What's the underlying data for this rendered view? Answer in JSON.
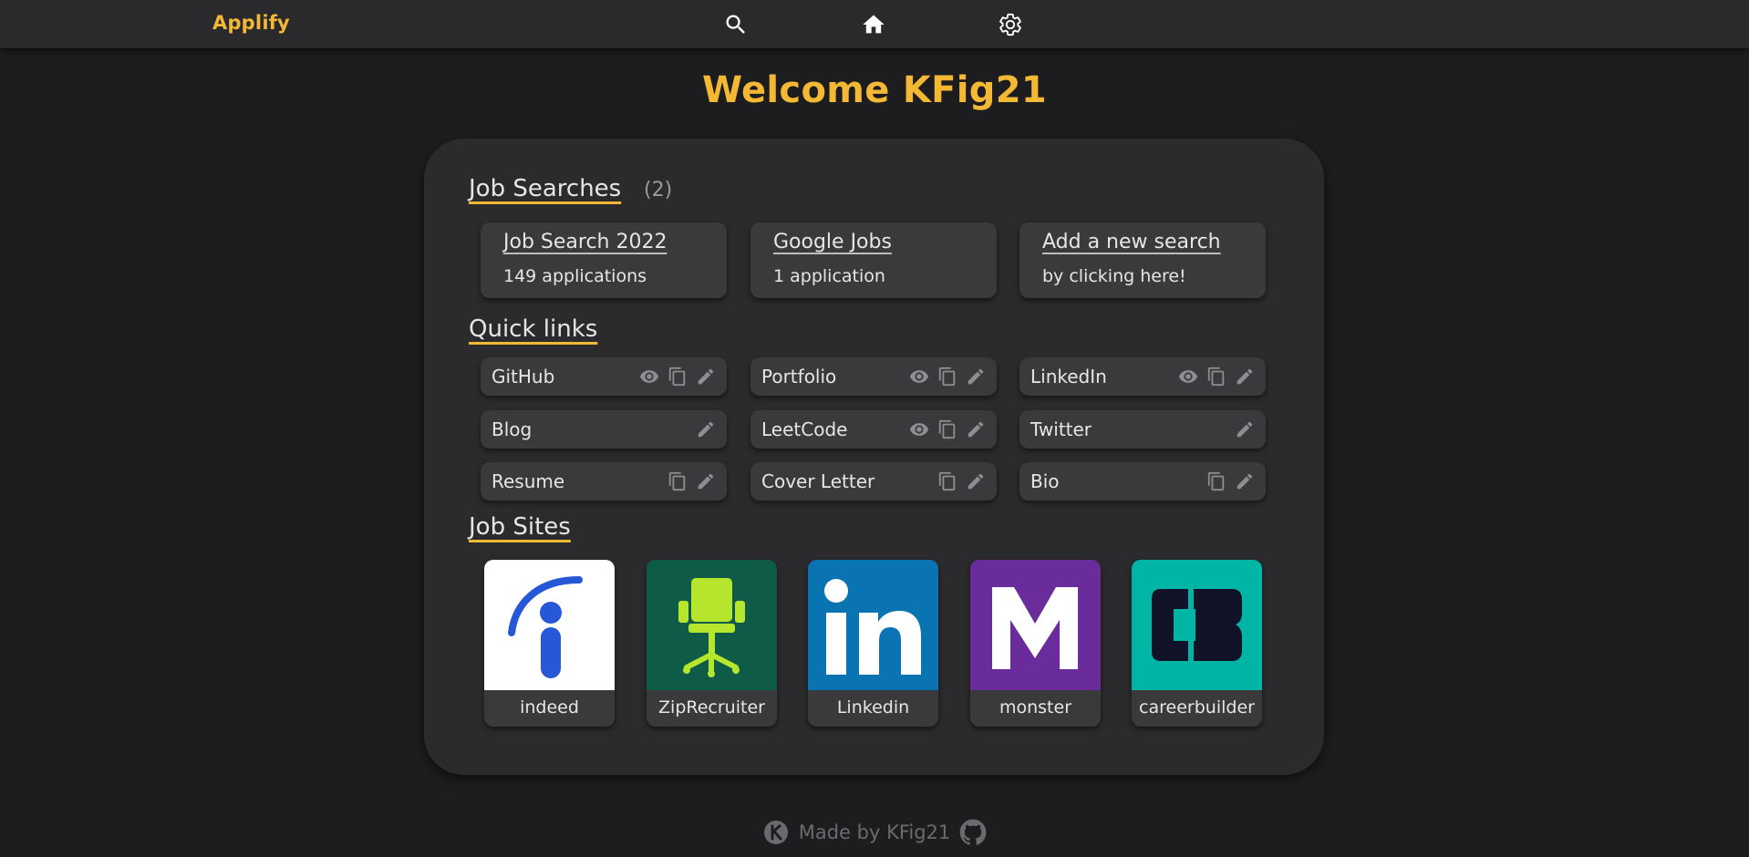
{
  "header": {
    "brand": "Applify",
    "nav": [
      {
        "name": "search-icon"
      },
      {
        "name": "home-icon"
      },
      {
        "name": "gear-icon"
      }
    ]
  },
  "welcome": "Welcome KFig21",
  "job_searches": {
    "title": "Job Searches",
    "count": "(2)",
    "items": [
      {
        "name": "Job Search 2022",
        "sub": "149 applications"
      },
      {
        "name": "Google Jobs",
        "sub": "1 application"
      },
      {
        "name": "Add a new search",
        "sub": "by clicking here!"
      }
    ]
  },
  "quick_links": {
    "title": "Quick links",
    "items": [
      {
        "label": "GitHub",
        "actions": [
          "eye-icon",
          "copy-icon",
          "pencil-icon"
        ]
      },
      {
        "label": "Portfolio",
        "actions": [
          "eye-icon",
          "copy-icon",
          "pencil-icon"
        ]
      },
      {
        "label": "LinkedIn",
        "actions": [
          "eye-icon",
          "copy-icon",
          "pencil-icon"
        ]
      },
      {
        "label": "Blog",
        "actions": [
          "pencil-icon"
        ]
      },
      {
        "label": "LeetCode",
        "actions": [
          "eye-icon",
          "copy-icon",
          "pencil-icon"
        ]
      },
      {
        "label": "Twitter",
        "actions": [
          "pencil-icon"
        ]
      },
      {
        "label": "Resume",
        "actions": [
          "copy-icon",
          "pencil-icon"
        ]
      },
      {
        "label": "Cover Letter",
        "actions": [
          "copy-icon",
          "pencil-icon"
        ]
      },
      {
        "label": "Bio",
        "actions": [
          "copy-icon",
          "pencil-icon"
        ]
      }
    ]
  },
  "job_sites": {
    "title": "Job Sites",
    "items": [
      {
        "name": "indeed",
        "logo": "indeed-logo",
        "bg": "#ffffff",
        "fg": "#2557d6"
      },
      {
        "name": "ZipRecruiter",
        "logo": "ziprecruiter-logo",
        "bg": "#0e5c48",
        "fg": "#b5e52c"
      },
      {
        "name": "Linkedin",
        "logo": "linkedin-logo",
        "bg": "#0a73b1",
        "fg": "#ffffff"
      },
      {
        "name": "monster",
        "logo": "monster-logo",
        "bg": "#6a2c9a",
        "fg": "#ffffff"
      },
      {
        "name": "careerbuilder",
        "logo": "careerbuilder-logo",
        "bg": "#00b4a6",
        "fg": "#101327"
      }
    ]
  },
  "footer": {
    "text": "Made by KFig21",
    "icons": [
      "kfig-logo-icon",
      "github-icon"
    ]
  },
  "colors": {
    "accent": "#f3b934",
    "background": "#1d1d1f",
    "card": "#2b2b2e",
    "tile": "#3a3a3d"
  }
}
